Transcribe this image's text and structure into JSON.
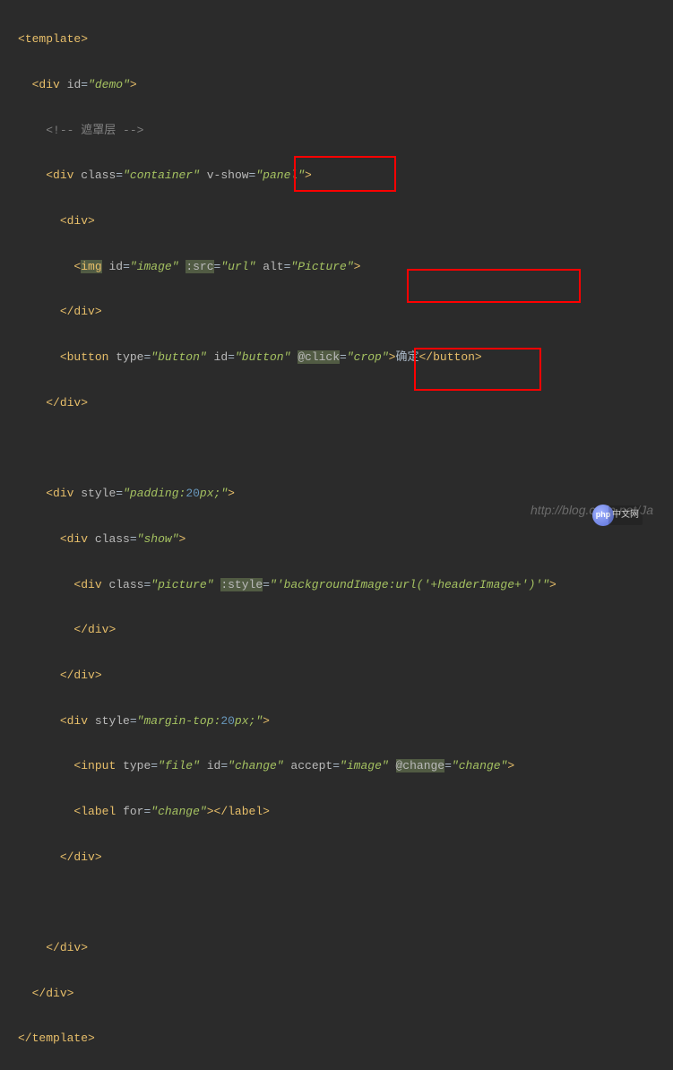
{
  "lines": {
    "l1_tag": "template",
    "l2_tag": "div",
    "l2_attr": "id",
    "l2_val": "demo",
    "l3_comment": "<!-- 遮罩层 -->",
    "l4_tag": "div",
    "l4_attr1": "class",
    "l4_val1": "container",
    "l4_attr2": "v-show",
    "l4_val2": "panel",
    "l5_tag": "div",
    "l6_tag": "img",
    "l6_attr1": "id",
    "l6_val1": "image",
    "l6_attr2": ":src",
    "l6_val2": "url",
    "l6_attr3": "alt",
    "l6_val3": "Picture",
    "l7_close": "div",
    "l8_tag": "button",
    "l8_attr1": "type",
    "l8_val1": "button",
    "l8_attr2": "id",
    "l8_val2": "button",
    "l8_attr3": "@click",
    "l8_val3": "crop",
    "l8_text": "确定",
    "l8_close": "button",
    "l9_close": "div",
    "l10_tag": "div",
    "l10_attr": "style",
    "l10_val_a": "padding:",
    "l10_val_b": "20",
    "l10_val_c": "px;",
    "l11_tag": "div",
    "l11_attr": "class",
    "l11_val": "show",
    "l12_tag": "div",
    "l12_attr1": "class",
    "l12_val1": "picture",
    "l12_attr2": ":style",
    "l12_val2": "'backgroundImage:url('+headerImage+')'",
    "l13_close": "div",
    "l14_close": "div",
    "l15_tag": "div",
    "l15_attr": "style",
    "l15_val_a": "margin-top:",
    "l15_val_b": "20",
    "l15_val_c": "px;",
    "l16_tag": "input",
    "l16_attr1": "type",
    "l16_val1": "file",
    "l16_attr2": "id",
    "l16_val2": "change",
    "l16_attr3": "accept",
    "l16_val3": "image",
    "l16_attr4": "@change",
    "l16_val4": "change",
    "l17_tag": "label",
    "l17_attr": "for",
    "l17_val": "change",
    "l17_close": "label",
    "l18_close": "div",
    "l19_close": "div",
    "l20_close": "div",
    "l21_close": "template"
  },
  "watermark": "http://blog.csdn.net/Ja",
  "wm_logo_text": "php",
  "wm_side_text": "中文网"
}
